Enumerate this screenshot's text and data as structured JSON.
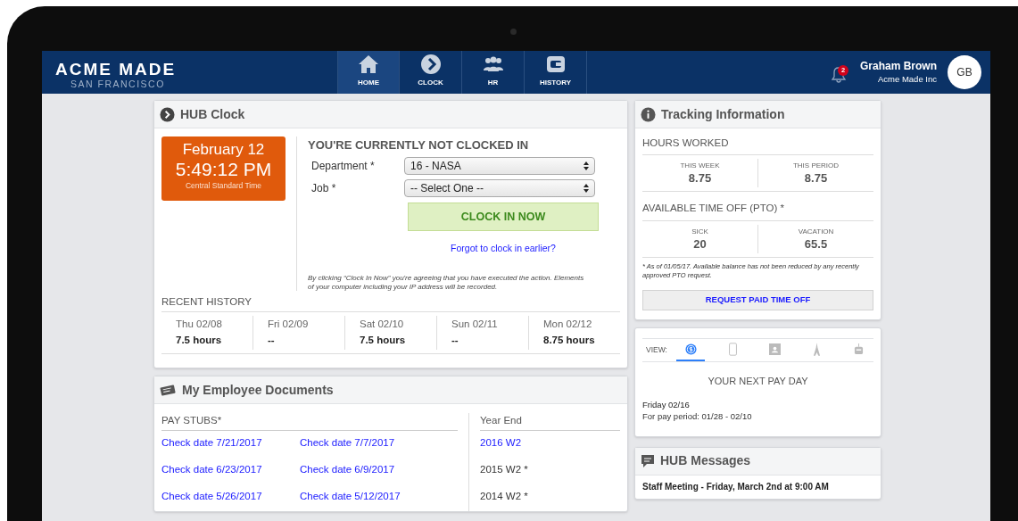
{
  "nav": {
    "brand": "ACME MADE",
    "brand_sub": "SAN FRANCISCO",
    "tabs": [
      {
        "label": "HOME",
        "kind": "home",
        "selected": true
      },
      {
        "label": "CLOCK",
        "kind": "clock",
        "selected": false
      },
      {
        "label": "HR",
        "kind": "people",
        "selected": false
      },
      {
        "label": "HISTORY",
        "kind": "history",
        "selected": false
      }
    ],
    "notification_count": "2",
    "user_name": "Graham Brown",
    "company": "Acme Made Inc",
    "initials": "GB"
  },
  "hub_clock": {
    "title": "HUB Clock",
    "date": "February 12",
    "time": "5:49:12 PM",
    "timezone": "Central Standard Time",
    "status": "YOU'RE CURRENTLY NOT CLOCKED IN",
    "fields": [
      {
        "label": "Department *",
        "value": "16 - NASA"
      },
      {
        "label": "Job *",
        "value": "-- Select One --"
      }
    ],
    "button": "CLOCK IN NOW",
    "link": "Forgot to clock in earlier?",
    "disclaimer": "By clicking “Clock In Now” you're agreeing that you have executed the action. Elements of your computer including your IP address will be recorded.",
    "recent_history": {
      "title": "RECENT HISTORY",
      "days": [
        {
          "day": "Thu 02/08",
          "hours": "7.5 hours"
        },
        {
          "day": "Fri 02/09",
          "hours": "--"
        },
        {
          "day": "Sat 02/10",
          "hours": "7.5 hours"
        },
        {
          "day": "Sun 02/11",
          "hours": "--"
        },
        {
          "day": "Mon 02/12",
          "hours": "8.75 hours"
        }
      ]
    }
  },
  "documents": {
    "title": "My Employee Documents",
    "pay_stubs": {
      "title": "PAY STUBS*",
      "links": [
        "Check date 7/21/2017",
        "Check date 7/7/2017",
        "Check date 6/23/2017",
        "Check date 6/9/2017",
        "Check date 5/26/2017",
        "Check date 5/12/2017"
      ]
    },
    "year_end": {
      "title": "Year End",
      "items": [
        {
          "text": "2016 W2",
          "link": true
        },
        {
          "text": "2015 W2 *",
          "link": false
        },
        {
          "text": "2014 W2 *",
          "link": false
        }
      ]
    }
  },
  "tracking": {
    "title": "Tracking Information",
    "sections": [
      {
        "title": "HOURS WORKED",
        "stats": [
          {
            "label": "THIS WEEK",
            "value": "8.75"
          },
          {
            "label": "THIS PERIOD",
            "value": "8.75"
          }
        ]
      },
      {
        "title": "AVAILABLE TIME OFF (PTO) *",
        "stats": [
          {
            "label": "SICK",
            "value": "20"
          },
          {
            "label": "VACATION",
            "value": "65.5"
          }
        ]
      }
    ],
    "note": "* As of 01/05/17. Available balance has not been reduced by any recently approved PTO request.",
    "button": "REQUEST PAID TIME OFF"
  },
  "payday": {
    "view_label": "VIEW:",
    "views": [
      {
        "kind": "money",
        "selected": true
      },
      {
        "kind": "phone",
        "selected": false
      },
      {
        "kind": "card",
        "selected": false
      },
      {
        "kind": "tower",
        "selected": false
      },
      {
        "kind": "bot",
        "selected": false
      }
    ],
    "heading": "YOUR NEXT PAY DAY",
    "date": "Friday 02/16",
    "period": "For pay period: 01/28 - 02/10"
  },
  "messages": {
    "title": "HUB Messages",
    "items": [
      "Staff Meeting - Friday, March 2nd at 9:00 AM"
    ]
  }
}
